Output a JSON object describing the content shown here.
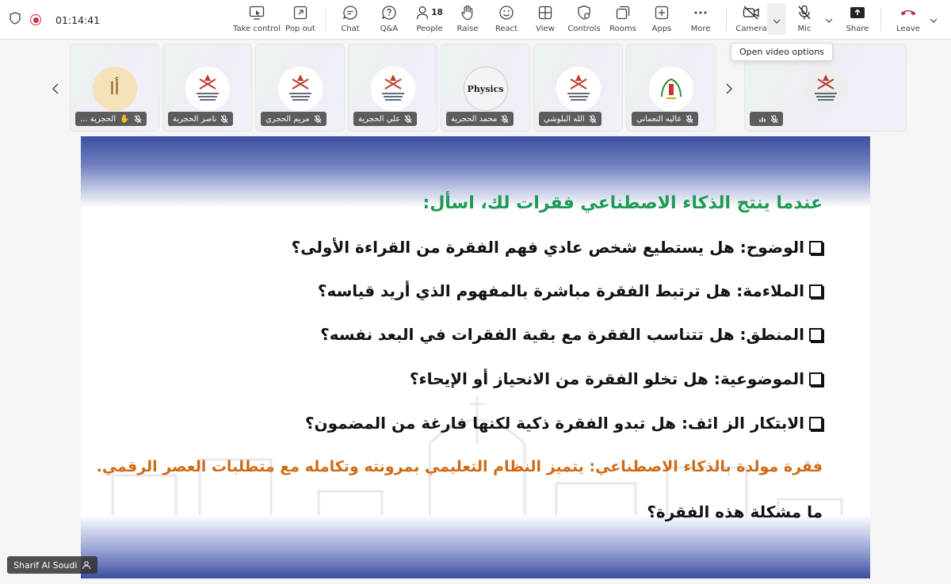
{
  "toolbar": {
    "timer": "01:14:41",
    "buttons": {
      "take_control": "Take control",
      "pop_out": "Pop out",
      "chat": "Chat",
      "qa": "Q&A",
      "people": "People",
      "people_count": "18",
      "raise": "Raise",
      "react": "React",
      "view": "View",
      "controls": "Controls",
      "rooms": "Rooms",
      "apps": "Apps",
      "more": "More",
      "camera": "Camera",
      "mic": "Mic",
      "share": "Share",
      "leave": "Leave"
    },
    "tooltip": "Open video options",
    "leave_color": "#c4314b"
  },
  "participants": [
    {
      "name": "الحجرية ...",
      "avatar_text": "أا"
    },
    {
      "name": "ناصر الحجرية"
    },
    {
      "name": "مريم الحجري"
    },
    {
      "name": "علي الحجرية"
    },
    {
      "name": "محمد الحجرية",
      "avatar_text": "Physics"
    },
    {
      "name": "الله البلوشي"
    },
    {
      "name": "عاليه النعماني"
    },
    {
      "name": ""
    }
  ],
  "slide": {
    "heading": "عندما ينتج الذكاء الاصطناعي فقرات لك، اسأل:",
    "items": [
      "الوضوح: هل يستطيع شخص عادي فهم الفقرة من القراءة الأولى؟",
      "الملاءمة: هل ترتبط الفقرة مباشرة بالمفهوم الذي أريد قياسه؟",
      "المنطق: هل تتناسب الفقرة مع بقية الفقرات في البعد نفسه؟",
      "الموضوعية: هل تخلو الفقرة من الانحياز أو الإيحاء؟",
      "الابتكار الز ائف: هل تبدو الفقرة ذكية لكنها فارغة من المضمون؟"
    ],
    "generated": "فقرة مولدة بالذكاء الاصطناعي: يتميز النظام التعليمي بمرونته وتكامله مع متطلبات العصر الرقمي.",
    "question": "ما مشكلة هذه الفقرة؟",
    "heading_color": "#1f9a56",
    "generated_color": "#d06a12"
  },
  "presenter": {
    "name": "Sharif Al Soudi"
  }
}
